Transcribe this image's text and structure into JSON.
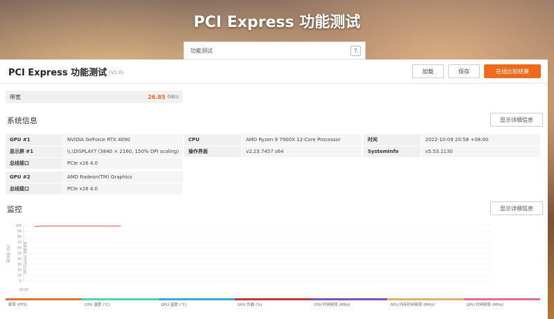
{
  "hero": {
    "title": "PCI Express 功能测试"
  },
  "tabs": {
    "active_label": "功能测试",
    "help_label": "?"
  },
  "panel": {
    "title": "PCI Express 功能测试",
    "version": "(V1.0)",
    "buttons": {
      "load": "加载",
      "save": "保存",
      "compare": "在线比较结果"
    }
  },
  "bandwidth": {
    "label": "带宽",
    "value": "26.85",
    "unit": "GB/s"
  },
  "system_info": {
    "title": "系统信息",
    "detail_button": "显示详细信息",
    "col1": [
      {
        "k": "GPU #1",
        "v": "NVIDIA GeForce RTX 4090"
      },
      {
        "k": "显示屏 #1",
        "v": "\\\\.\\DISPLAY7 (3840 × 2160, 150% DPI scaling)"
      },
      {
        "k": "总线接口",
        "v": "PCIe x16 4.0"
      }
    ],
    "col1b": [
      {
        "k": "GPU #2",
        "v": "AMD Radeon(TM) Graphics"
      },
      {
        "k": "总线接口",
        "v": "PCIe x16 4.0"
      }
    ],
    "col2": [
      {
        "k": "CPU",
        "v": "AMD Ryzen 9 7900X 12-Core Processor"
      },
      {
        "k": "操作界面",
        "v": "v2.23.7457 s64"
      }
    ],
    "col3": [
      {
        "k": "时间",
        "v": "2022-10-09 20:58 +08:00"
      },
      {
        "k": "SystemInfo",
        "v": "v5.53.1130"
      }
    ]
  },
  "monitoring": {
    "title": "监控",
    "detail_button": "显示详细信息",
    "y_axis_label": "百分比 (%)",
    "series_axis_label": "PCI Express 功能测试",
    "x_start_label": "00:00"
  },
  "chart_data": {
    "type": "line",
    "ylim": [
      0,
      100
    ],
    "yticks": [
      0,
      10,
      20,
      30,
      40,
      50,
      60,
      70,
      80,
      90,
      100
    ],
    "x": [
      0,
      1,
      2,
      3,
      4,
      5,
      6,
      7,
      8,
      9,
      10
    ],
    "series": [
      {
        "values": [
          98,
          99,
          99,
          99,
          99,
          99,
          99,
          99,
          99,
          99,
          99
        ],
        "color": "#d9534f"
      }
    ],
    "grid": true
  },
  "legend": [
    {
      "label": "帧率 (FPS)",
      "color": "#e0703a"
    },
    {
      "label": "CPU 温度 (°C)",
      "color": "#4cd3b0"
    },
    {
      "label": "GPU 温度 (°C)",
      "color": "#3aa6e0"
    },
    {
      "label": "GPU 负载 (%)",
      "color": "#c0353a"
    },
    {
      "label": "CPU 时钟频率 (MHz)",
      "color": "#7b4fb8"
    },
    {
      "label": "GPU 内存时钟频率 (MHz)",
      "color": "#d9b26a"
    },
    {
      "label": "GPU 时钟频率 (MHz)",
      "color": "#e06a9a"
    }
  ]
}
